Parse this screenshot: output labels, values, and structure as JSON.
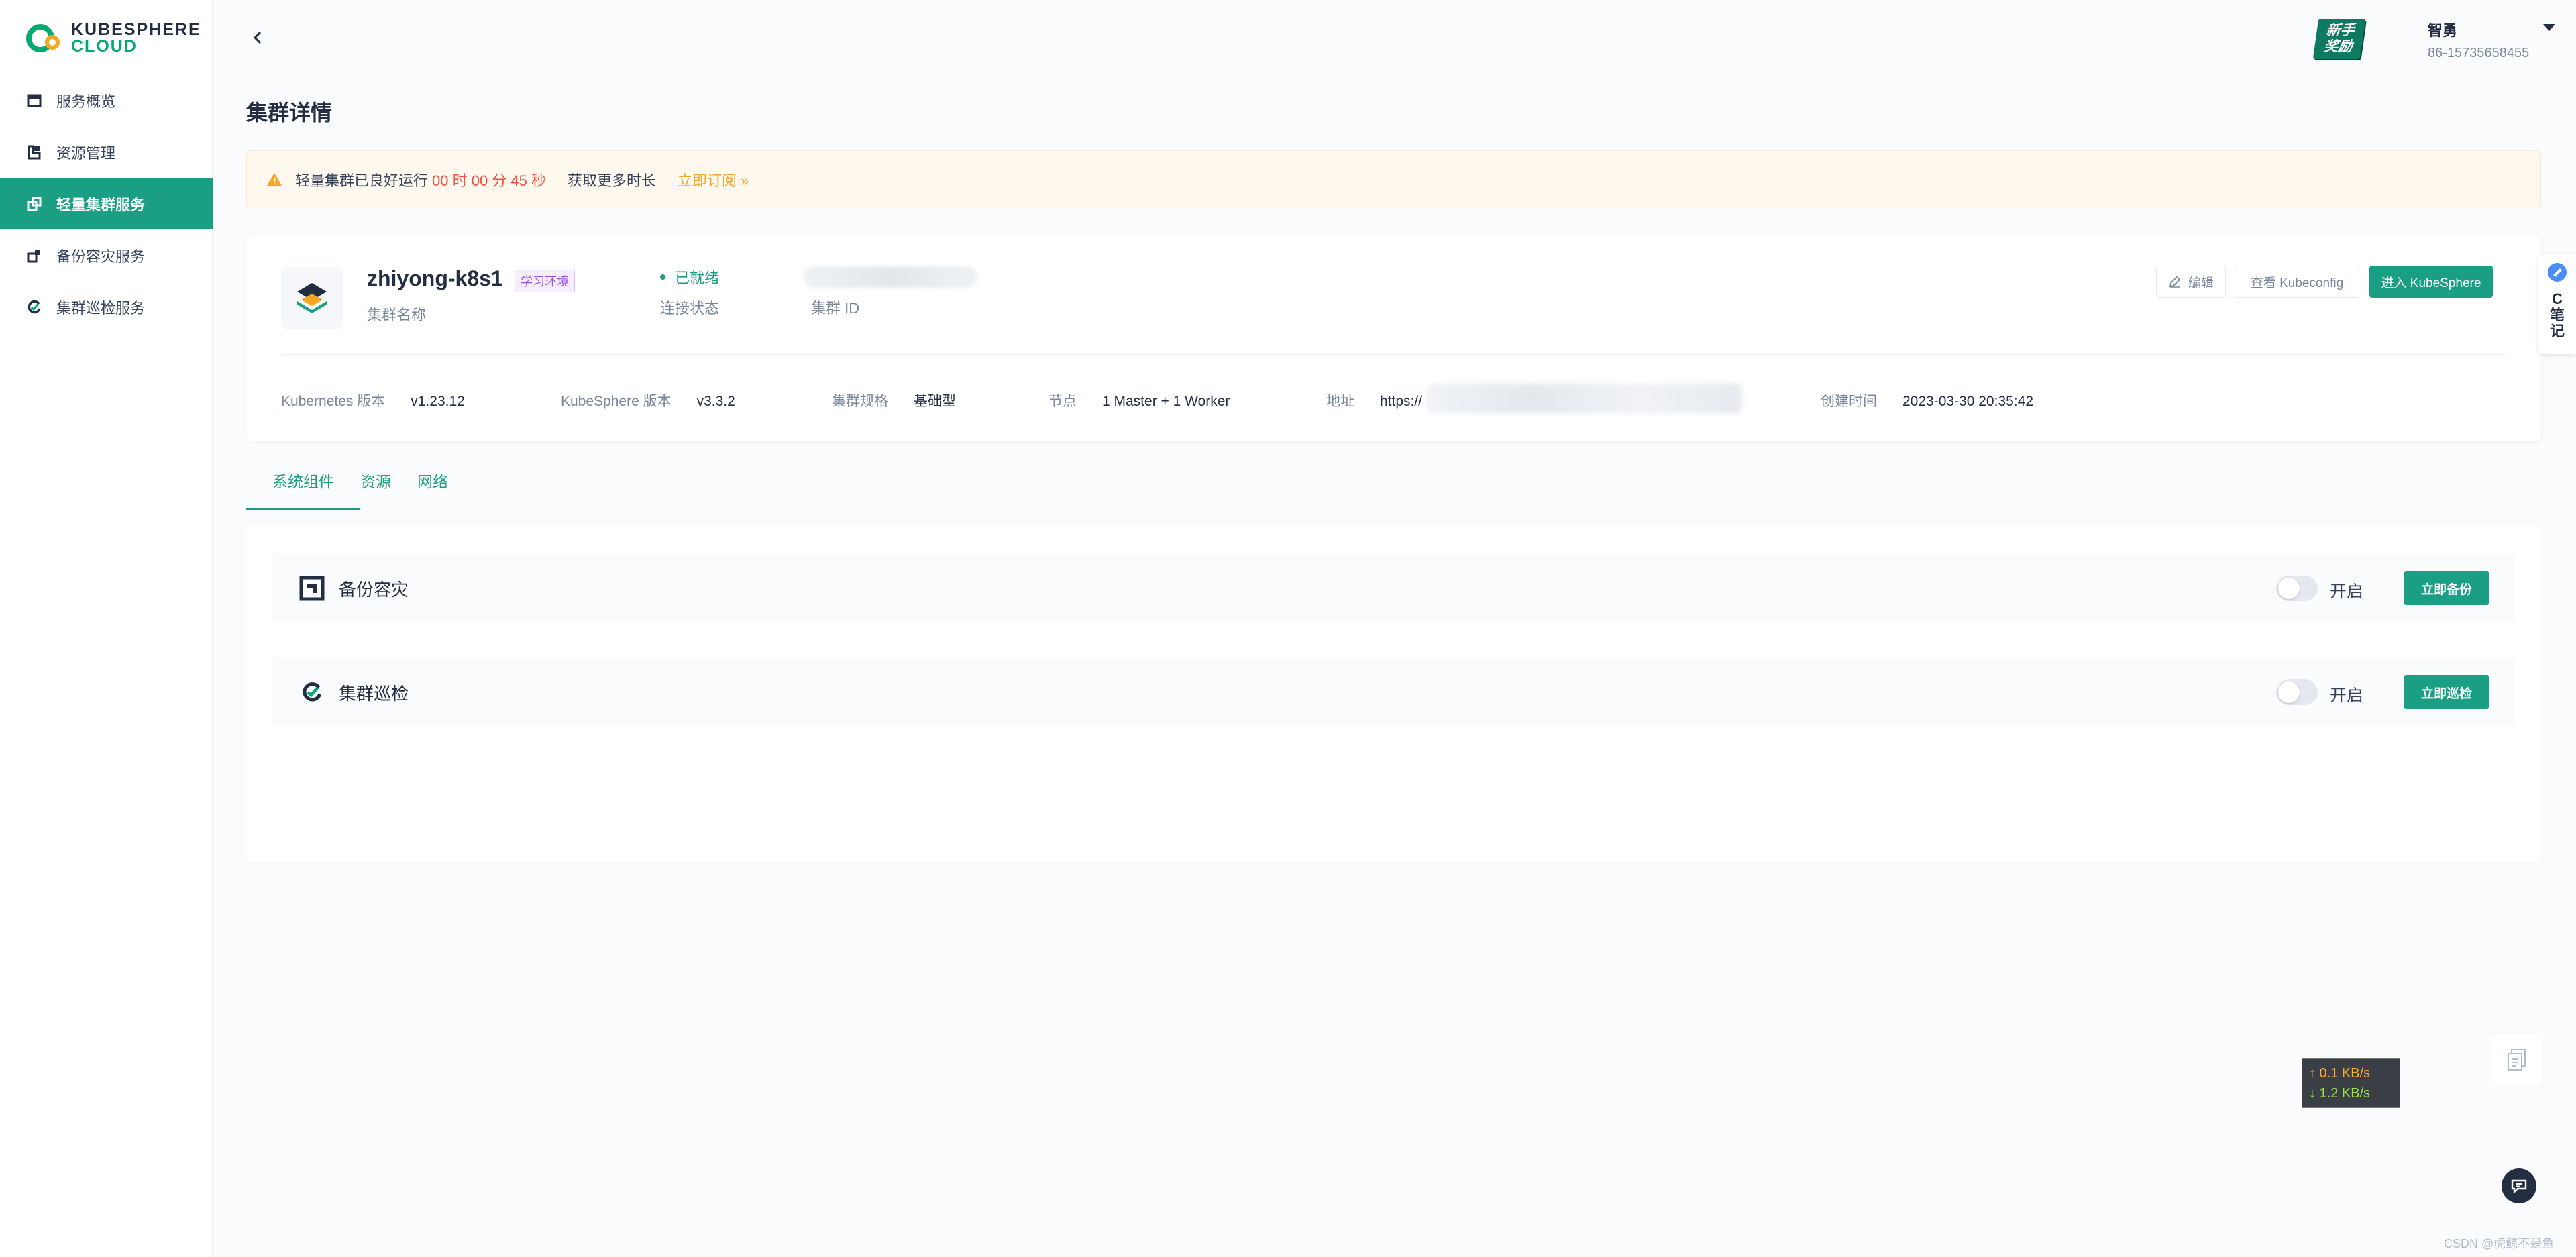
{
  "brand": {
    "line1": "KUBESPHERE",
    "line2": "CLOUD",
    "accent": "#1a9e84"
  },
  "sidebar": {
    "items": [
      {
        "label": "服务概览",
        "icon": "overview-icon"
      },
      {
        "label": "资源管理",
        "icon": "resource-icon"
      },
      {
        "label": "轻量集群服务",
        "icon": "cluster-icon",
        "active": true
      },
      {
        "label": "备份容灾服务",
        "icon": "backup-icon"
      },
      {
        "label": "集群巡检服务",
        "icon": "inspection-icon"
      }
    ]
  },
  "header": {
    "badge": {
      "line1": "新手",
      "line2": "奖励"
    },
    "user": {
      "name": "智勇",
      "phone": "86-15735658455"
    }
  },
  "page": {
    "title": "集群详情"
  },
  "alert": {
    "prefix": "轻量集群已良好运行",
    "timer": "00 时 00 分 45 秒",
    "more": "获取更多时长",
    "subscribe": "立即订阅 »"
  },
  "cluster": {
    "name": "zhiyong-k8s1",
    "env_tag": "学习环境",
    "name_label": "集群名称",
    "status": "已就绪",
    "status_label": "连接状态",
    "id_label": "集群 ID",
    "buttons": {
      "edit": "编辑",
      "kubeconfig": "查看 Kubeconfig",
      "enter": "进入 KubeSphere"
    },
    "meta": [
      {
        "key": "Kubernetes 版本",
        "value": "v1.23.12"
      },
      {
        "key": "KubeSphere 版本",
        "value": "v3.3.2"
      },
      {
        "key": "集群规格",
        "value": "基础型"
      },
      {
        "key": "节点",
        "value": "1 Master + 1 Worker"
      },
      {
        "key": "地址",
        "value": "https://"
      },
      {
        "key": "创建时间",
        "value": "2023-03-30 20:35:42"
      }
    ]
  },
  "tabs": [
    {
      "label": "系统组件",
      "active": true
    },
    {
      "label": "资源"
    },
    {
      "label": "网络"
    }
  ],
  "components": [
    {
      "label": "备份容灾",
      "toggle_label": "开启",
      "enabled": false,
      "button": "立即备份"
    },
    {
      "label": "集群巡检",
      "toggle_label": "开启",
      "enabled": false,
      "button": "立即巡检"
    }
  ],
  "widgets": {
    "note": {
      "c": "C",
      "line1": "笔",
      "line2": "记"
    },
    "speed": {
      "up": "↑ 0.1 KB/s",
      "down": "↓ 1.2 KB/s"
    },
    "watermark": "CSDN @虎鲸不是鱼"
  }
}
